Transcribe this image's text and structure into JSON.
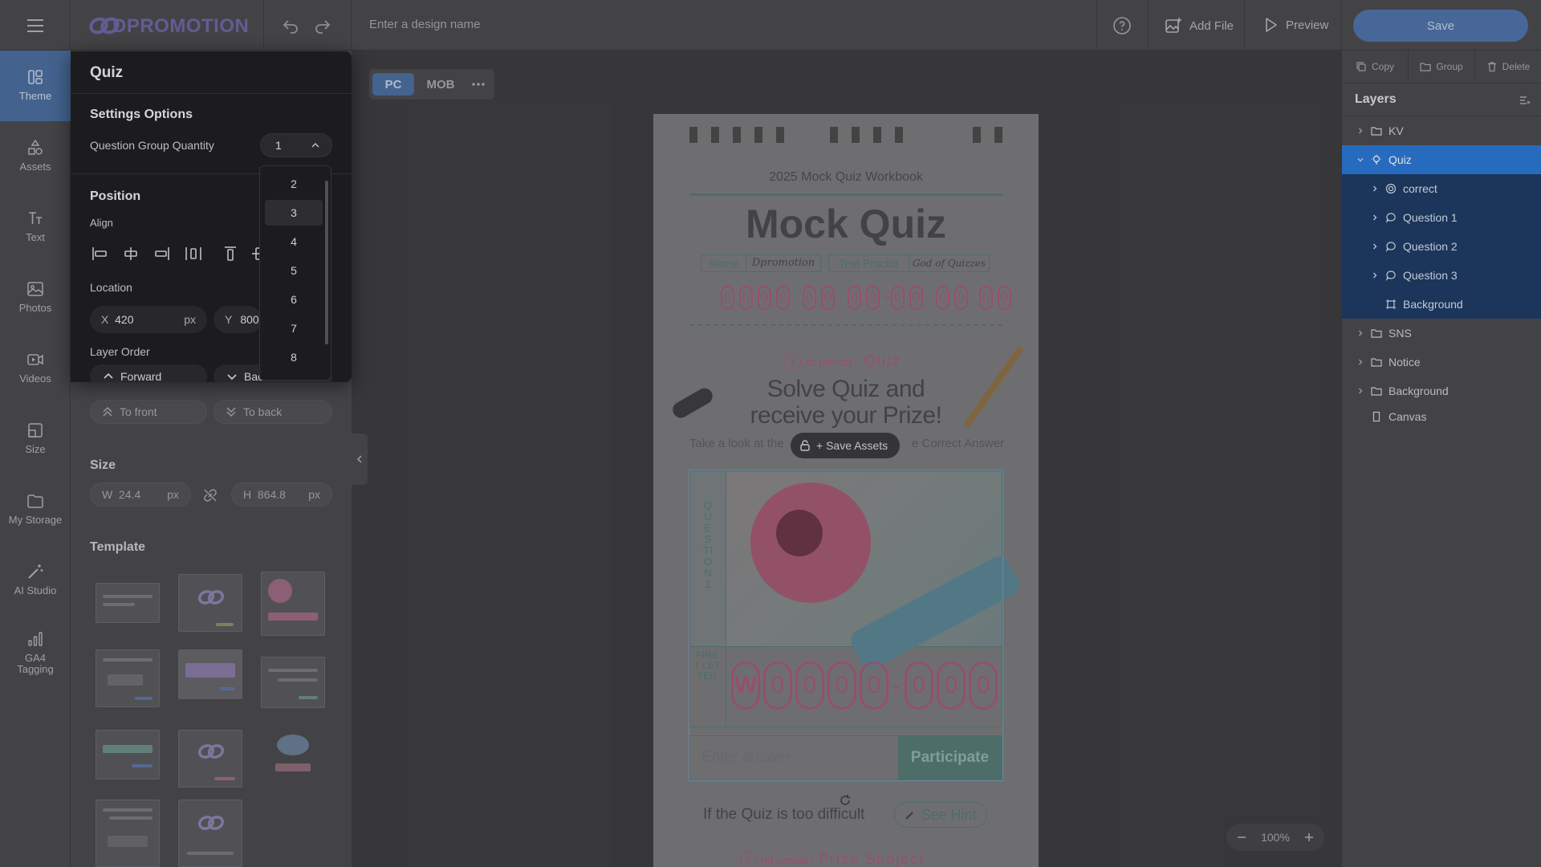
{
  "topbar": {
    "logo": "DPROMOTION",
    "design_name_placeholder": "Enter a design name",
    "add_file": "Add File",
    "preview": "Preview",
    "save": "Save"
  },
  "rail": [
    {
      "label": "Theme",
      "icon": "theme-icon"
    },
    {
      "label": "Assets",
      "icon": "shapes-icon"
    },
    {
      "label": "Text",
      "icon": "text-icon"
    },
    {
      "label": "Photos",
      "icon": "image-icon"
    },
    {
      "label": "Videos",
      "icon": "video-icon"
    },
    {
      "label": "Size",
      "icon": "resize-icon"
    },
    {
      "label": "My Storage",
      "icon": "folder-icon"
    },
    {
      "label": "AI Studio",
      "icon": "magic-wand-icon"
    },
    {
      "label": "GA4 Tagging",
      "icon": "analytics-icon"
    }
  ],
  "quiz_panel": {
    "title": "Quiz",
    "settings_heading": "Settings Options",
    "qty_label": "Question Group Quantity",
    "qty_value": "1",
    "qty_options": [
      "2",
      "3",
      "4",
      "5",
      "6",
      "7",
      "8"
    ],
    "qty_hovered": "3",
    "position_heading": "Position",
    "align_label": "Align",
    "location_label": "Location",
    "x_label": "X",
    "x_value": "420",
    "x_unit": "px",
    "y_label": "Y",
    "y_value": "800",
    "layer_order_label": "Layer Order",
    "forward": "Forward",
    "backward": "Backward"
  },
  "panel": {
    "to_front": "To front",
    "to_back": "To back",
    "size_heading": "Size",
    "w_label": "W",
    "w_value": "24.4",
    "h_label": "H",
    "h_value": "864.8",
    "unit": "px",
    "template_heading": "Template"
  },
  "canvas": {
    "view_pc": "PC",
    "view_mob": "MOB",
    "workbook_title": "2025 Mock Quiz Workbook",
    "main_title": "Mock Quiz",
    "name_label": "Name",
    "name_value": "Dpromotion",
    "proctor_label": "Test Proctor",
    "proctor_value": "God of Quizzes",
    "period1_num": "1",
    "period1_label": "st period :",
    "period1_word": "Quiz",
    "headline_line1": "Solve Quiz and",
    "headline_line2": "receive your Prize!",
    "subline_left": "Take a look at the",
    "subline_right": "e Correct Answer",
    "save_assets": "+ Save Assets",
    "question_vertical": "QUESTION 1",
    "first_letter_vertical": "FIRST LETTER",
    "answer_first": "W",
    "answer_placeholder": "Enter answer",
    "participate": "Participate",
    "hint_text": "If the Quiz is too difficult",
    "see_hint": "See Hint",
    "period2_num": "2",
    "period2_label": "nd period :",
    "period2_word": "Prize Subject",
    "zoom": "100%"
  },
  "layers_panel": {
    "copy": "Copy",
    "group": "Group",
    "delete": "Delete",
    "title": "Layers",
    "items": [
      {
        "label": "KV",
        "icon": "folder-icon",
        "level": 0,
        "expandable": true
      },
      {
        "label": "Quiz",
        "icon": "bulb-icon",
        "level": 0,
        "expandable": true,
        "state": "selected"
      },
      {
        "label": "correct",
        "icon": "target-icon",
        "level": 1,
        "expandable": true
      },
      {
        "label": "Question 1",
        "icon": "chat-icon",
        "level": 1,
        "expandable": true
      },
      {
        "label": "Question 2",
        "icon": "chat-icon",
        "level": 1,
        "expandable": true
      },
      {
        "label": "Question 3",
        "icon": "chat-icon",
        "level": 1,
        "expandable": true
      },
      {
        "label": "Background",
        "icon": "frame-icon",
        "level": 1,
        "expandable": false
      },
      {
        "label": "SNS",
        "icon": "folder-icon",
        "level": 0,
        "expandable": true
      },
      {
        "label": "Notice",
        "icon": "folder-icon",
        "level": 0,
        "expandable": true
      },
      {
        "label": "Background",
        "icon": "folder-icon",
        "level": 0,
        "expandable": true
      },
      {
        "label": "Canvas",
        "icon": "page-icon",
        "level": 0,
        "expandable": false
      }
    ]
  },
  "colors": {
    "accent": "#2b78d6",
    "save_button": "#4f74aa",
    "modal_bg": "#1e1e20",
    "quiz_pink": "#a8587a",
    "quiz_green": "#557a74"
  }
}
